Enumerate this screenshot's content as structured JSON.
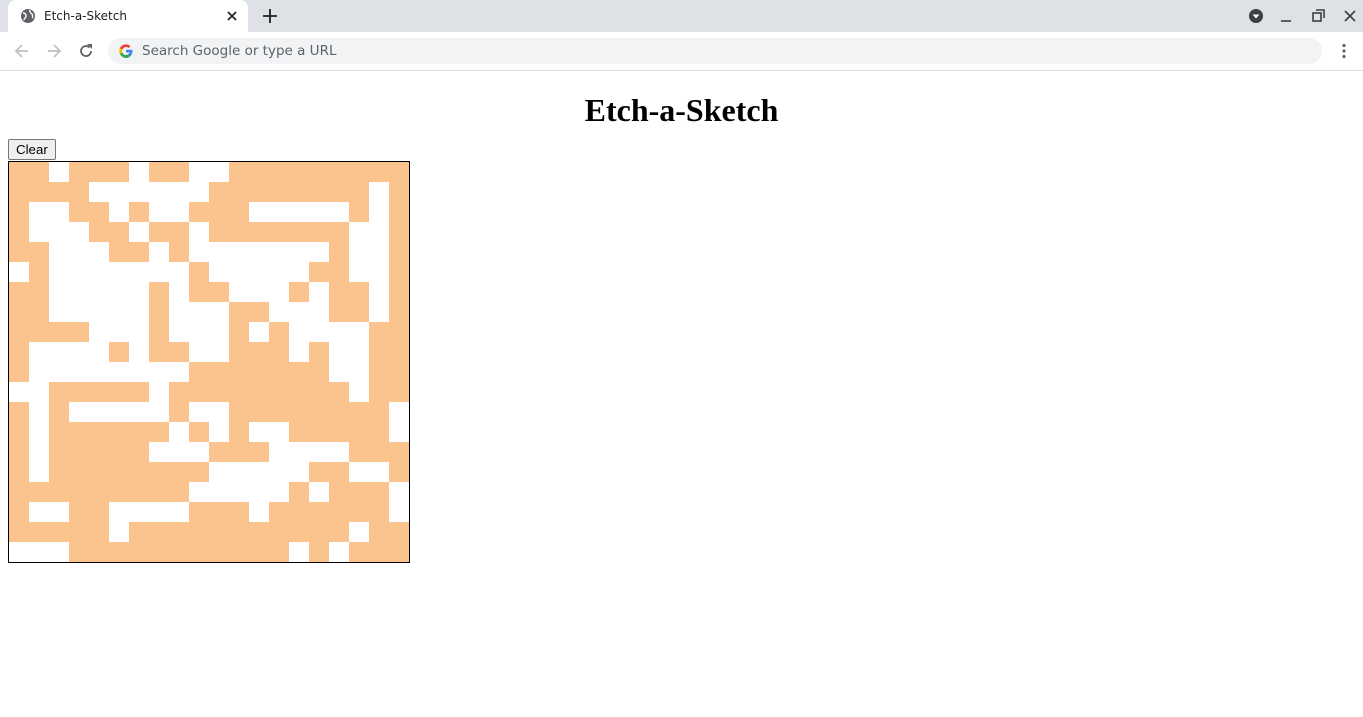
{
  "browser": {
    "tab_title": "Etch-a-Sketch",
    "omnibox_placeholder": "Search Google or type a URL",
    "icons": {
      "favicon": "globe-icon",
      "tab_close": "close-icon",
      "new_tab": "plus-icon",
      "profile": "profile-dropdown-icon",
      "minimize": "minimize-icon",
      "restore": "restore-icon",
      "close_window": "close-icon",
      "back": "back-arrow-icon",
      "forward": "forward-arrow-icon",
      "reload": "reload-icon",
      "google": "google-g-icon",
      "menu": "kebab-menu-icon"
    }
  },
  "page": {
    "title": "Etch-a-Sketch",
    "clear_label": "Clear"
  },
  "grid": {
    "size": 20,
    "fill_color": "#fbc38e",
    "empty_color": "#ffffff",
    "rows": [
      "11011101100111111111",
      "11110000001111111101",
      "10011010011100000101",
      "10001101101111111001",
      "11000110100000001001",
      "01000000010000011001",
      "11000001011000101101",
      "11000001000110001101",
      "11110001000101000011",
      "10000101100111010011",
      "10000000011111110011",
      "00111110111111111011",
      "10100000100111111110",
      "10111111010100111110",
      "10111110001110000111",
      "10111111110000011001",
      "11111111100000101110",
      "10011000011101111110",
      "11111011111111111011",
      "00011111111111010111"
    ]
  }
}
